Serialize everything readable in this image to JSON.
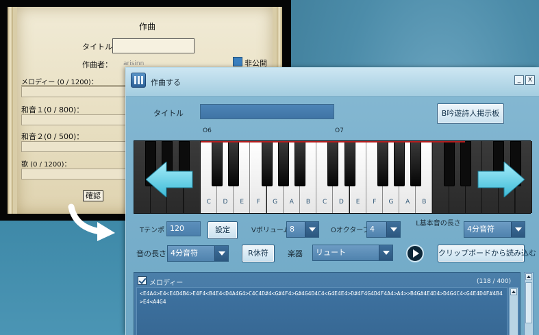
{
  "scroll": {
    "title": "作曲",
    "title_label": "タイトル：",
    "composer_label": "作曲者：",
    "composer_value": "arisinn",
    "private_label": "非公開",
    "melody_label": "メロディー (0 / 1200)：",
    "harmony1_label": "和音１(0 / 800)：",
    "harmony2_label": "和音２(0 / 500)：",
    "song_label": "歌 (0 / 1200)：",
    "confirm_label": "確認"
  },
  "window": {
    "title": "作曲する",
    "minimize": "_",
    "close": "X",
    "title_label": "タイトル",
    "board_button": "B吟遊詩人掲示板",
    "octave6_label": "O6",
    "octave7_label": "O7",
    "note_names": [
      "C",
      "D",
      "E",
      "F",
      "G",
      "A",
      "B",
      "C",
      "D",
      "E",
      "F",
      "G",
      "A",
      "B"
    ],
    "tempo_label": "Tテンポ",
    "tempo_value": "120",
    "set_button": "設定",
    "volume_label": "Vボリューム",
    "volume_value": "8",
    "octave_label": "Oオクターブ",
    "octave_value": "4",
    "base_length_label": "L基本音の長さ",
    "base_length_value": "4分音符",
    "length_label": "音の長さ",
    "length_value": "4分音符",
    "rest_button": "R休符",
    "instrument_label": "楽器",
    "instrument_value": "リュート",
    "clipboard_button": "クリップボードから読み込む",
    "melody": {
      "label": "メロディー",
      "count": "(118 / 400)",
      "text": "<E4A4>E4<E4D4B4>E4F4<B4E4<D4A4G4>C4C4D#4<G#4F4>G#4G4D4C4<G4E4E4>D#4F4G4D4F4A4>A4>>B4G#4E4D4>D4G4C4<G4E4D4F#4B4>E4<A4G4"
    }
  },
  "colors": {
    "window_bg": "#86b9d3",
    "title_field": "#4d84b6",
    "accent_red": "#b31c1c",
    "arrow_cyan": "#63d3e8"
  }
}
